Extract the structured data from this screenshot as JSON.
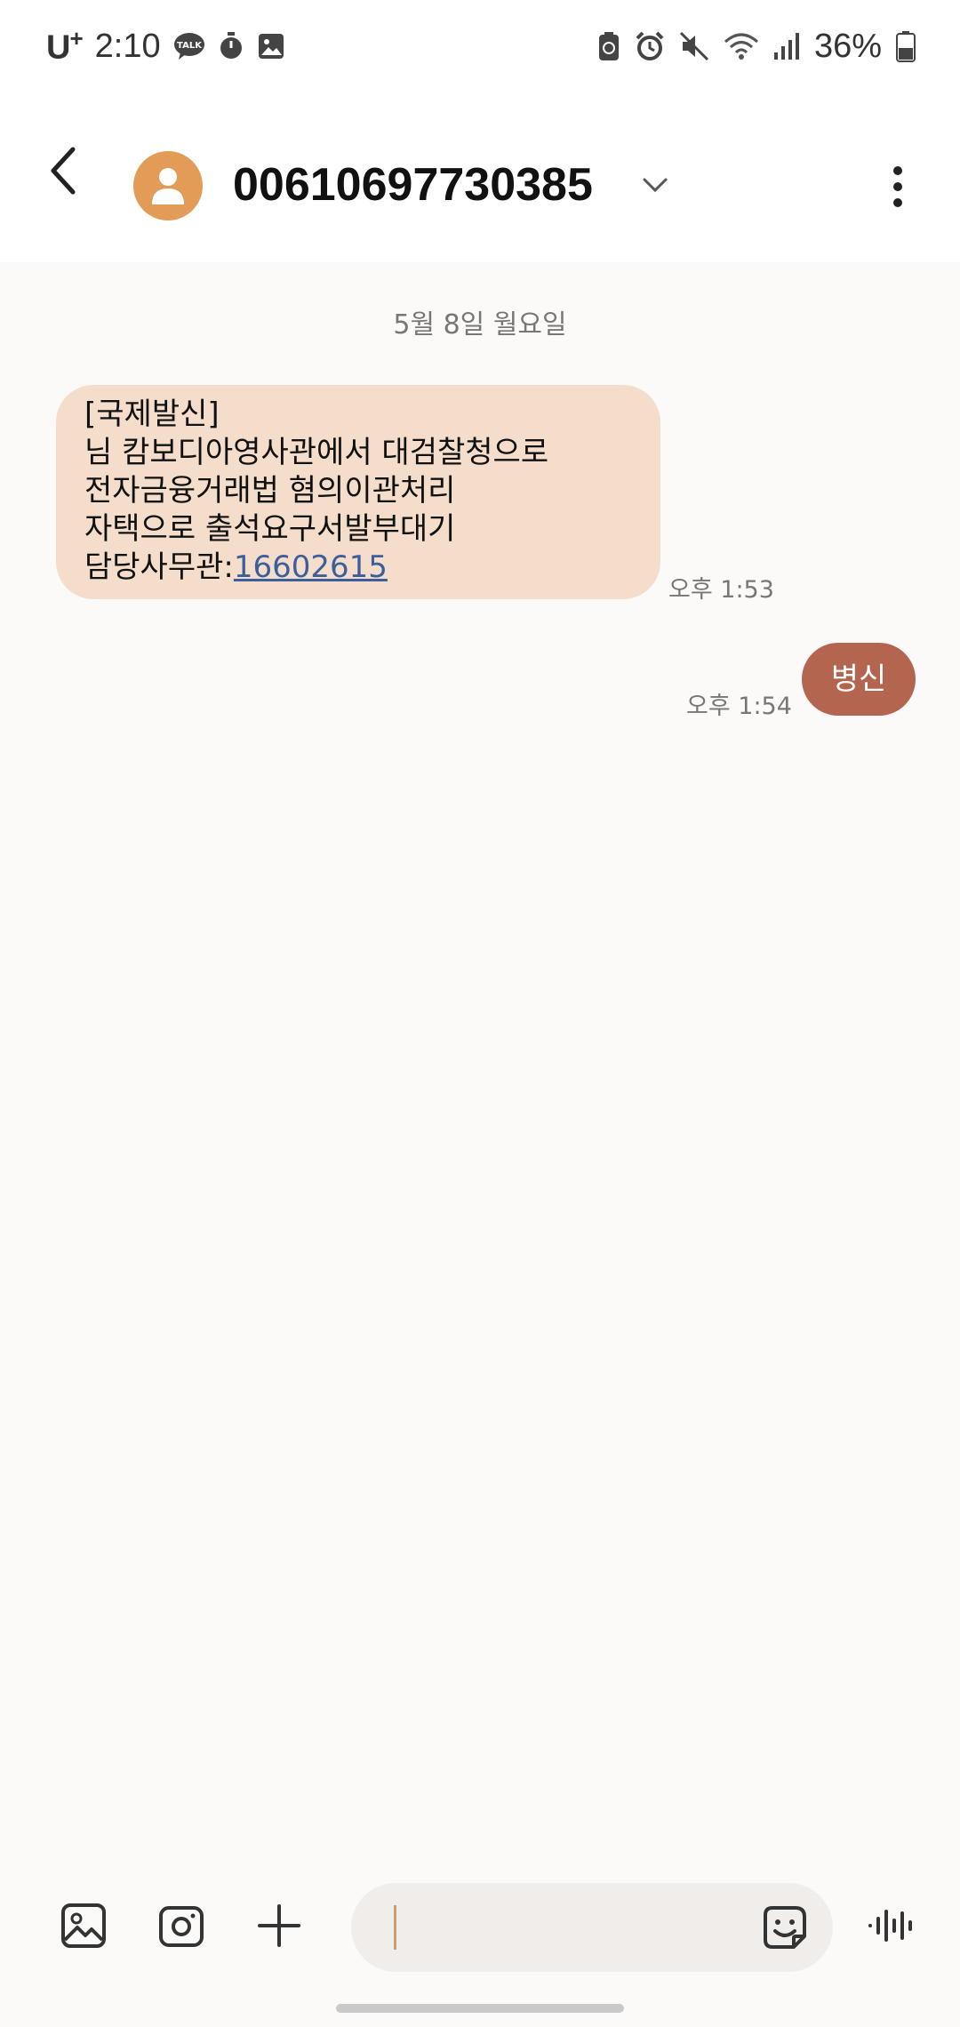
{
  "status_bar": {
    "carrier": "U",
    "carrier_sup": "+",
    "time": "2:10",
    "battery": "36%",
    "icons": [
      "talk-icon",
      "timer-icon",
      "gallery-icon",
      "battery-saver-icon",
      "alarm-icon",
      "mute-icon",
      "wifi-icon",
      "signal-icon",
      "battery-icon"
    ]
  },
  "header": {
    "contact": "00610697730385",
    "back_icon": "chevron-left-icon",
    "avatar_icon": "person-icon",
    "dropdown_icon": "chevron-down-icon",
    "more_icon": "more-vertical-icon"
  },
  "conversation": {
    "date": "5월 8일 월요일",
    "incoming": {
      "lines": [
        "[국제발신]",
        "님 캄보디아영사관에서 대검찰청으로",
        "전자금융거래법 혐의이관처리",
        "자택으로 출석요구서발부대기"
      ],
      "last_prefix": "담당사무관:",
      "phone": "16602615",
      "time": "오후 1:53"
    },
    "outgoing": {
      "text": "병신",
      "time": "오후 1:54"
    }
  },
  "composer": {
    "value": "",
    "icons": [
      "image-icon",
      "camera-icon",
      "plus-icon",
      "emoji-icon",
      "voice-icon"
    ]
  },
  "colors": {
    "incoming_bubble": "#f4decb",
    "outgoing_bubble": "#b4654f",
    "avatar": "#e29c57",
    "link": "#3d5e9a"
  }
}
